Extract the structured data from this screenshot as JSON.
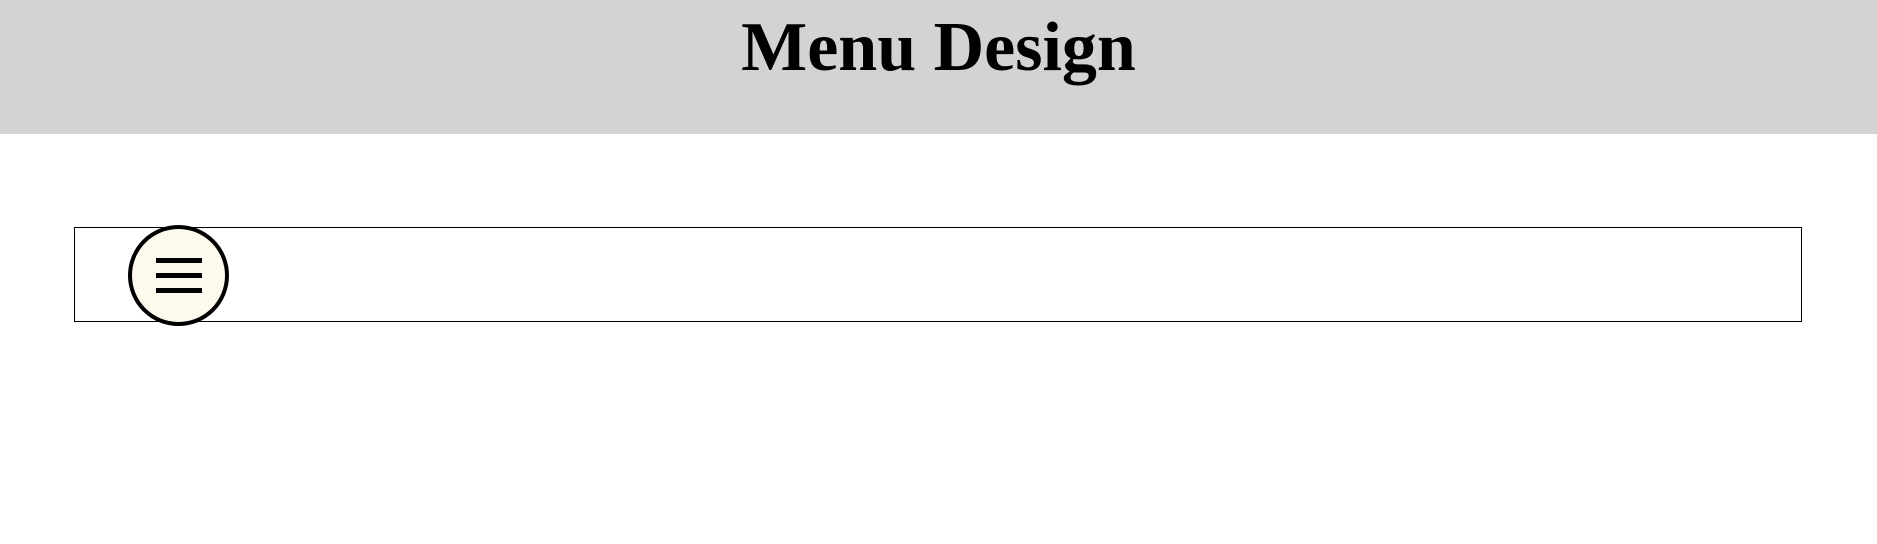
{
  "header": {
    "title": "Menu Design",
    "background_color": "#d3d3d3"
  },
  "menu": {
    "toggle_icon": "hamburger-menu-icon",
    "toggle_background_color": "#fdf9ec"
  }
}
